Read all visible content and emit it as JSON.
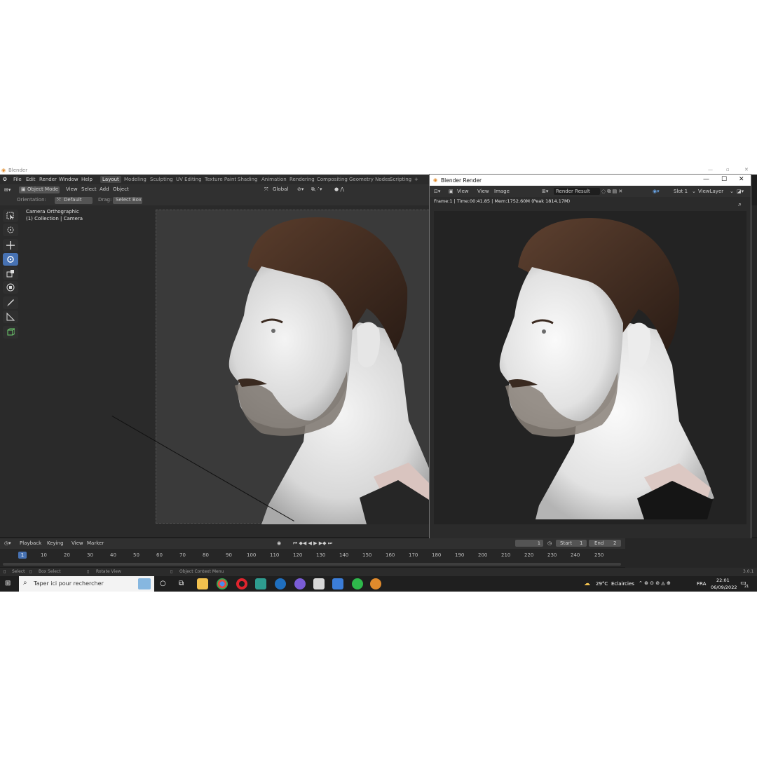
{
  "app": {
    "window_title": "Blender",
    "version": "3.0.1"
  },
  "menu": {
    "file": "File",
    "edit": "Edit",
    "render": "Render",
    "window": "Window",
    "help": "Help"
  },
  "workspaces": [
    "Layout",
    "Modeling",
    "Sculpting",
    "UV Editing",
    "Texture Paint",
    "Shading",
    "Animation",
    "Rendering",
    "Compositing",
    "Geometry Nodes",
    "Scripting",
    "+"
  ],
  "viewport_header": {
    "mode": "Object Mode",
    "view": "View",
    "select": "Select",
    "add": "Add",
    "object": "Object",
    "transform": "Global"
  },
  "tool_header": {
    "orientation_label": "Orientation:",
    "orientation_value": "Default",
    "drag_label": "Drag:",
    "drag_value": "Select Box"
  },
  "viewport_overlay": {
    "line1": "Camera Orthographic",
    "line2": "(1) Collection | Camera"
  },
  "render_window": {
    "title": "Blender Render",
    "view": "View",
    "view2": "View",
    "image": "Image",
    "image_name": "Render Result",
    "slot": "Slot 1",
    "layer": "ViewLayer",
    "stats": "Frame:1 | Time:00:41.85 | Mem:1752.60M (Peak 1814.17M)"
  },
  "timeline": {
    "playback": "Playback",
    "keying": "Keying",
    "view": "View",
    "marker": "Marker",
    "current_frame": "1",
    "start_label": "Start",
    "start_value": "1",
    "end_label": "End",
    "end_value": "2",
    "ticks": [
      "1",
      "10",
      "20",
      "30",
      "40",
      "50",
      "60",
      "70",
      "80",
      "90",
      "100",
      "110",
      "120",
      "130",
      "140",
      "150",
      "160",
      "170",
      "180",
      "190",
      "200",
      "210",
      "220",
      "230",
      "240",
      "250"
    ]
  },
  "statusbar": {
    "select": "Select",
    "box_select": "Box Select",
    "rotate_view": "Rotate View",
    "context_menu": "Object Context Menu"
  },
  "taskbar": {
    "search_placeholder": "Taper ici pour rechercher",
    "weather_temp": "29°C",
    "weather_text": "Eclaircies",
    "language": "FRA",
    "time": "22:01",
    "date": "06/09/2022",
    "notifications": "21"
  },
  "colors": {
    "accent": "#4772b3",
    "bg": "#1d1d1d",
    "panel": "#303030"
  }
}
